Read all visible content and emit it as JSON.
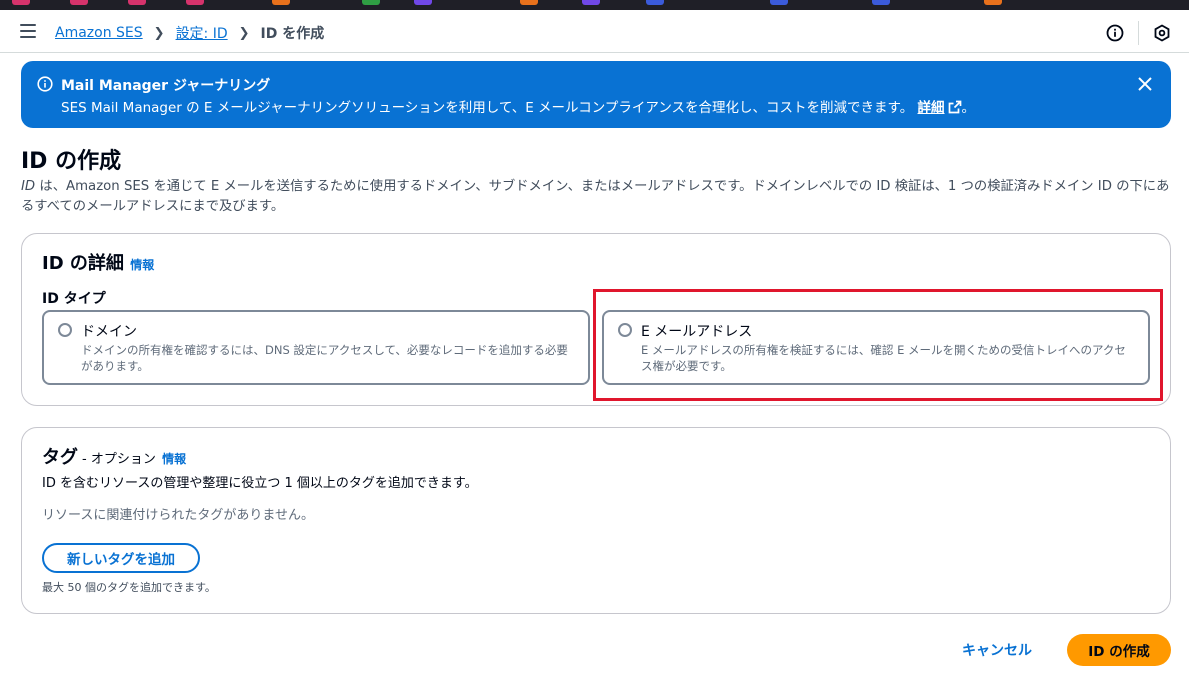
{
  "colors": {
    "accent": "#0972d3",
    "primary_button": "#ff9900",
    "highlight_box": "#e0162d",
    "flash_bg": "#0972d3"
  },
  "topbar": {
    "menu_icon": "hamburger-icon",
    "breadcrumb": {
      "item1": "Amazon SES",
      "item2": "設定: ID",
      "current": "ID を作成"
    },
    "icons": [
      "info-icon",
      "settings-shield-icon"
    ]
  },
  "flash": {
    "title": "Mail Manager ジャーナリング",
    "body": "SES Mail Manager の E メールジャーナリングソリューションを利用して、E メールコンプライアンスを合理化し、コストを削減できます。",
    "link": "詳細",
    "suffix": "。"
  },
  "page": {
    "title": "ID の作成",
    "desc_italic": "ID",
    "desc": " は、Amazon SES を通じて E メールを送信するために使用するドメイン、サブドメイン、またはメールアドレスです。ドメインレベルでの ID 検証は、1 つの検証済みドメイン ID の下にあるすべてのメールアドレスにまで及びます。"
  },
  "identity_details": {
    "title": "ID の詳細",
    "info": "情報",
    "type_label": "ID タイプ",
    "options": [
      {
        "title": "ドメイン",
        "desc": "ドメインの所有権を確認するには、DNS 設定にアクセスして、必要なレコードを追加する必要があります。"
      },
      {
        "title": "E メールアドレス",
        "desc": "E メールアドレスの所有権を検証するには、確認 E メールを開くための受信トレイへのアクセス権が必要です。"
      }
    ]
  },
  "tags": {
    "title": "タグ",
    "optional": "- オプション",
    "info": "情報",
    "desc": "ID を含むリソースの管理や整理に役立つ 1 個以上のタグを追加できます。",
    "empty": "リソースに関連付けられたタグがありません。",
    "add_button": "新しいタグを追加",
    "hint": "最大 50 個のタグを追加できます。"
  },
  "footer": {
    "cancel": "キャンセル",
    "create": "ID の作成"
  }
}
